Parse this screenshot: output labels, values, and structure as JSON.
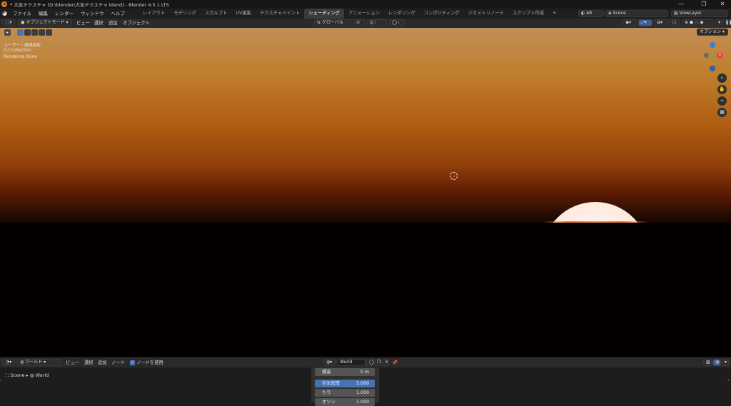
{
  "window": {
    "title": "* 大気テクスチャ [D:\\blender\\大気テクスチャ.blend] - Blender 4.5.1 LTS",
    "controls": [
      "—",
      "❐",
      "✕"
    ]
  },
  "menubar": {
    "menus": [
      "ファイル",
      "編集",
      "レンダー",
      "ウィンドウ",
      "ヘルプ"
    ],
    "workspaces": [
      "レイアウト",
      "モデリング",
      "スカルプト",
      "UV編集",
      "テクスチャペイント",
      "シェーディング",
      "アニメーション",
      "レンダリング",
      "コンポジティング",
      "ジオメトリノード",
      "スクリプト作成"
    ],
    "active_workspace": "シェーディング",
    "add_tab": "+",
    "render_engine": "AR",
    "scene": "Scene",
    "view_layer": "ViewLayer"
  },
  "viewport_header": {
    "mode": "オブジェクトモード",
    "menus": [
      "ビュー",
      "選択",
      "追加",
      "オブジェクト"
    ],
    "transform_orientation": "グローバル",
    "options_button": "オプション"
  },
  "viewport": {
    "view_name": "ユーザー・透視投影",
    "collection": "(1) Collection",
    "status": "Rendering Done",
    "gizmo_axes": [
      "X",
      "Y",
      "Z"
    ]
  },
  "node_editor": {
    "editor_type": "ワールド",
    "menus": [
      "ビュー",
      "選択",
      "追加",
      "ノード"
    ],
    "use_nodes_label": "ノードを使用",
    "use_nodes_checked": true,
    "world_name": "World",
    "breadcrumb": [
      "Scene",
      "World"
    ]
  },
  "properties_panel": {
    "rows": [
      {
        "label": "標高",
        "value": "0 m",
        "highlight": false
      },
      {
        "label": "空気密度",
        "value": "5.000",
        "highlight": true
      },
      {
        "label": "ちり",
        "value": "1.000",
        "highlight": false
      },
      {
        "label": "オゾン",
        "value": "1.000",
        "highlight": false
      }
    ]
  },
  "colors": {
    "accent_active": "#4772b3",
    "sun_core": "#fff7f1",
    "sky_top": "#c08f55",
    "sky_mid": "#ae5c10",
    "ground": "#050000"
  }
}
